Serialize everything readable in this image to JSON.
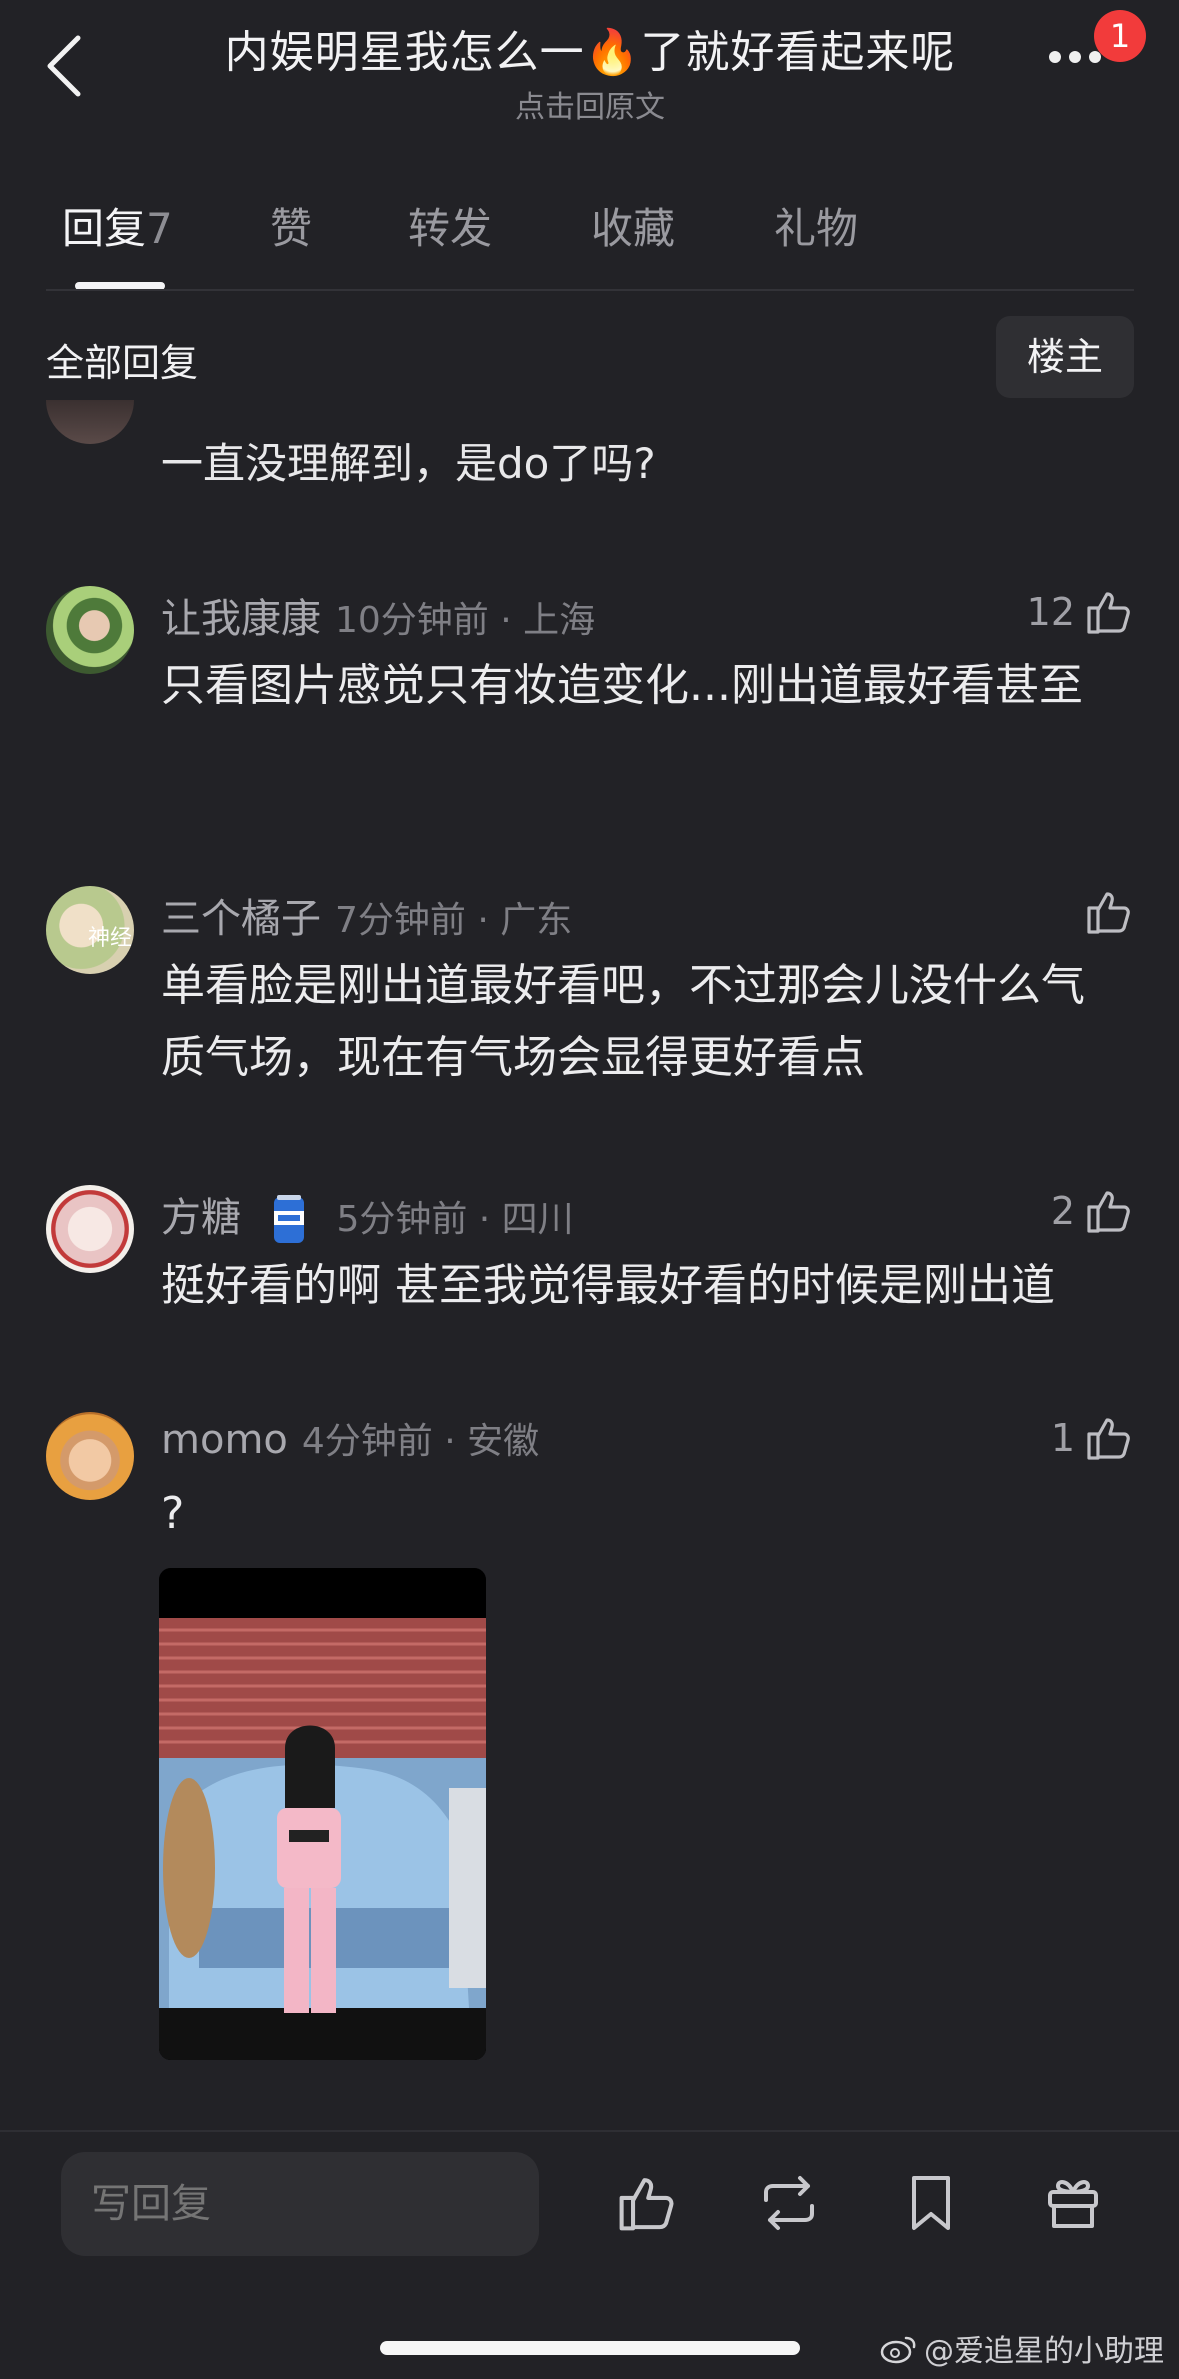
{
  "header": {
    "title": "内娱明星我怎么一🔥了就好看起来呢",
    "subtitle": "点击回原文",
    "notification_count": "1"
  },
  "tabs": [
    {
      "label": "回复",
      "count": "7"
    },
    {
      "label": "赞"
    },
    {
      "label": "转发"
    },
    {
      "label": "收藏"
    },
    {
      "label": "礼物"
    }
  ],
  "section": {
    "title": "全部回复",
    "filter_label": "楼主"
  },
  "partial_comment": {
    "text": "一直没理解到，是do了吗?"
  },
  "comments": [
    {
      "name": "让我康康",
      "time": "10分钟前 · 上海",
      "likes": "12",
      "text": "只看图片感觉只有妆造变化...刚出道最好看甚至",
      "avatar_label": ""
    },
    {
      "name": "三个橘子",
      "time": "7分钟前 · 广东",
      "likes": "",
      "text": "单看脸是刚出道最好看吧，不过那会儿没什么气质气场，现在有气场会显得更好看点",
      "avatar_label": "神经"
    },
    {
      "name": "方糖",
      "time": "5分钟前 · 四川",
      "likes": "2",
      "text": "挺好看的啊 甚至我觉得最好看的时候是刚出道",
      "avatar_label": ""
    },
    {
      "name": "momo",
      "time": "4分钟前 · 安徽",
      "likes": "1",
      "text": "?",
      "avatar_label": ""
    }
  ],
  "bottom_bar": {
    "reply_placeholder": "写回复"
  },
  "watermark": "@爱追星的小助理",
  "colors": {
    "background": "#222226",
    "badge": "#f23b3b",
    "text_primary": "#ececee",
    "text_secondary": "#9b9ba1"
  }
}
